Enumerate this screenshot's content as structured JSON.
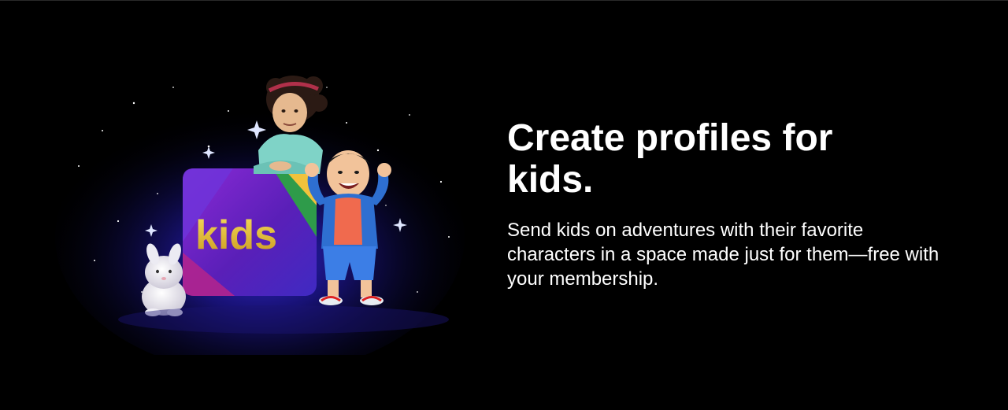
{
  "feature": {
    "title": "Create profiles for kids.",
    "subtitle": "Send kids on adventures with their favorite characters in a space made just for them—free with your membership.",
    "logo_text": "kids"
  },
  "colors": {
    "background": "#000000",
    "text": "#ffffff",
    "glow": "#2a1fbf",
    "kids_logo_gold": "#e8c23a"
  }
}
